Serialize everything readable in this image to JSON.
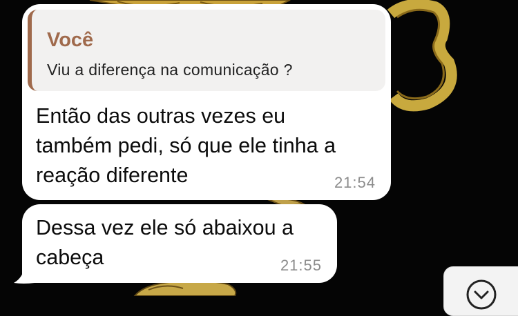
{
  "colors": {
    "background": "#050505",
    "bubble": "#ffffff",
    "quote_accent": "#a06a4c",
    "timestamp": "#8c8c8c"
  },
  "messages": [
    {
      "reply_to": {
        "author": "Você",
        "text": "Viu a diferença na comunicação ?"
      },
      "text": "Então das outras vezes eu\ntambém pedi, só que ele tinha a\nreação diferente",
      "time": "21:54"
    },
    {
      "text": "Dessa vez ele só abaixou a\ncabeça",
      "time": "21:55"
    }
  ],
  "scroll_button": {
    "icon": "chevron-down-circle-icon"
  }
}
